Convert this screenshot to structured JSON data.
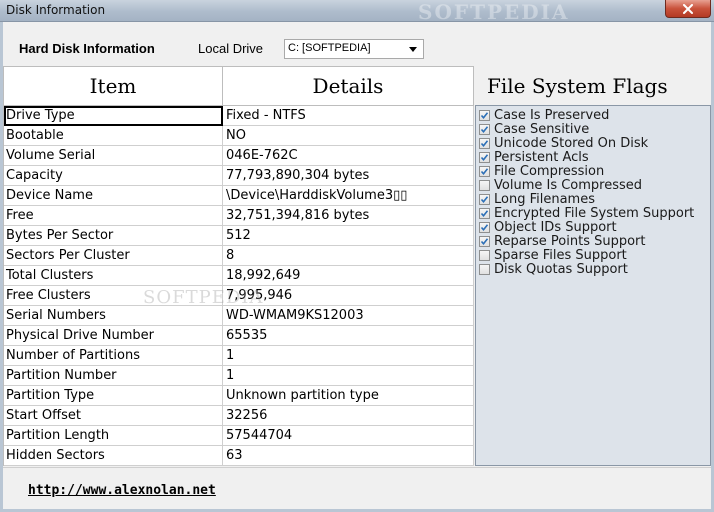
{
  "window": {
    "title": "Disk Information",
    "watermark": "SOFTPEDIA"
  },
  "header": {
    "section_label": "Hard Disk Information",
    "drive_label": "Local Drive",
    "drive_selected": "C: [SOFTPEDIA]"
  },
  "grid": {
    "columns": [
      "Item",
      "Details"
    ],
    "rows": [
      {
        "item": "Drive Type",
        "details": "Fixed - NTFS"
      },
      {
        "item": "Bootable",
        "details": "NO"
      },
      {
        "item": "Volume Serial",
        "details": "046E-762C"
      },
      {
        "item": "Capacity",
        "details": "77,793,890,304 bytes"
      },
      {
        "item": "Device Name",
        "details": "\\Device\\HarddiskVolume3▯▯"
      },
      {
        "item": "Free",
        "details": "32,751,394,816 bytes"
      },
      {
        "item": "Bytes Per Sector",
        "details": "512"
      },
      {
        "item": "Sectors Per Cluster",
        "details": "8"
      },
      {
        "item": "Total Clusters",
        "details": "18,992,649"
      },
      {
        "item": "Free Clusters",
        "details": "7,995,946"
      },
      {
        "item": "Serial Numbers",
        "details": "WD-WMAM9KS12003"
      },
      {
        "item": "Physical Drive Number",
        "details": "65535"
      },
      {
        "item": "Number of Partitions",
        "details": "1"
      },
      {
        "item": "Partition Number",
        "details": "1"
      },
      {
        "item": "Partition Type",
        "details": "Unknown partition type"
      },
      {
        "item": "Start Offset",
        "details": "32256"
      },
      {
        "item": "Partition Length",
        "details": "57544704"
      },
      {
        "item": "Hidden Sectors",
        "details": "63"
      }
    ]
  },
  "flags": {
    "title": "File System Flags",
    "items": [
      {
        "label": "Case Is Preserved",
        "checked": true
      },
      {
        "label": "Case Sensitive",
        "checked": true
      },
      {
        "label": "Unicode Stored On Disk",
        "checked": true
      },
      {
        "label": "Persistent Acls",
        "checked": true
      },
      {
        "label": "File Compression",
        "checked": true
      },
      {
        "label": "Volume Is Compressed",
        "checked": false
      },
      {
        "label": "Long Filenames",
        "checked": true
      },
      {
        "label": "Encrypted File System Support",
        "checked": true
      },
      {
        "label": "Object IDs Support",
        "checked": true
      },
      {
        "label": "Reparse Points Support",
        "checked": true
      },
      {
        "label": "Sparse Files Support",
        "checked": false
      },
      {
        "label": "Disk Quotas Support",
        "checked": false
      }
    ]
  },
  "footer": {
    "link": "http://www.alexnolan.net"
  },
  "colors": {
    "flags_panel": "#dde3ea",
    "checkmark": "#2c6fb7",
    "close_button": "#c9523b"
  }
}
